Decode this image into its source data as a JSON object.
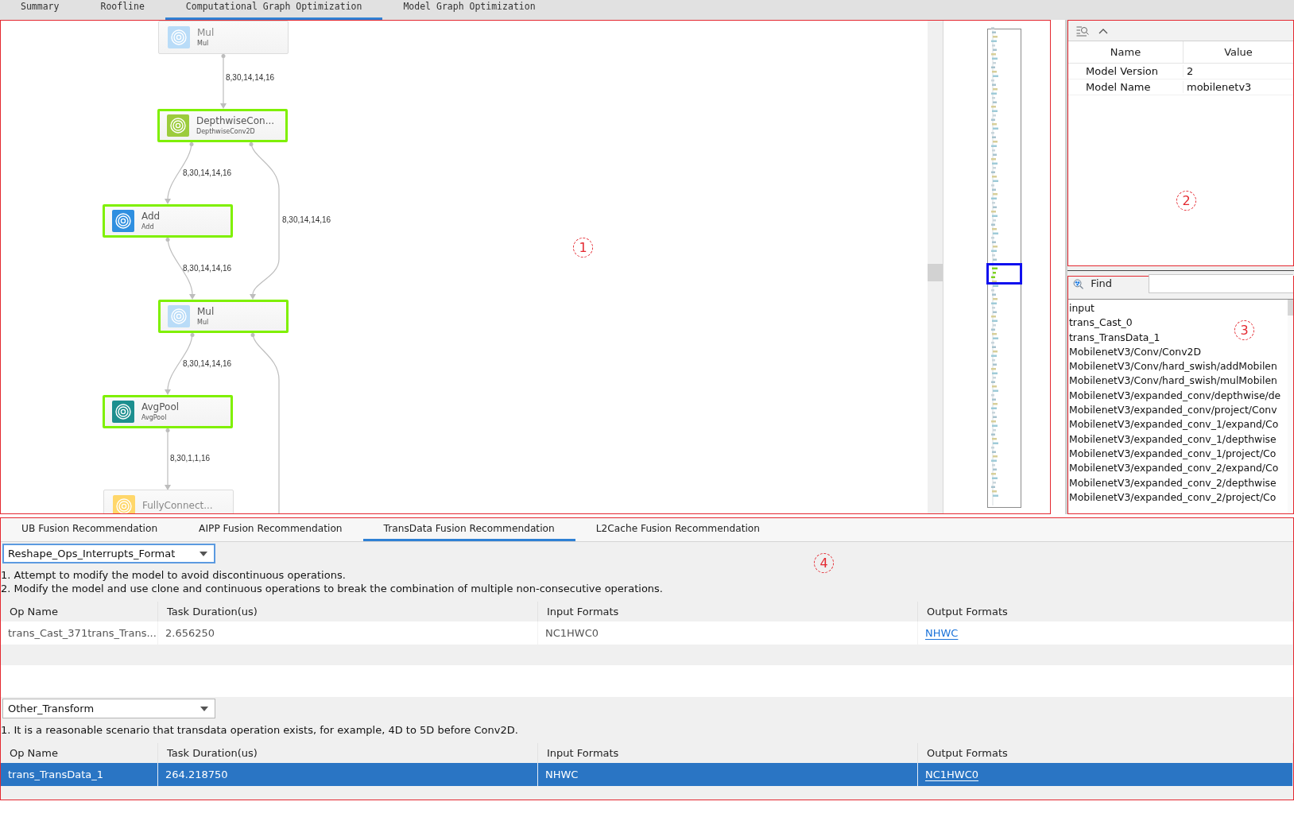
{
  "top_tabs": [
    {
      "label": "Summary",
      "selected": false
    },
    {
      "label": "Roofline",
      "selected": false
    },
    {
      "label": "Computational Graph Optimization",
      "selected": true
    },
    {
      "label": "Model Graph Optimization",
      "selected": false
    }
  ],
  "graph": {
    "callout": "1",
    "nodes": [
      {
        "title": "Mul",
        "subtitle": "Mul",
        "highlighted": false,
        "color": "#b9dcf8"
      },
      {
        "title": "DepthwiseCon...",
        "subtitle": "DepthwiseConv2D",
        "highlighted": true,
        "color": "#9ccc3c"
      },
      {
        "title": "Add",
        "subtitle": "Add",
        "highlighted": true,
        "color": "#2f8fe0"
      },
      {
        "title": "Mul",
        "subtitle": "Mul",
        "highlighted": true,
        "color": "#b9dcf8"
      },
      {
        "title": "AvgPool",
        "subtitle": "AvgPool",
        "highlighted": true,
        "color": "#1d8f8f"
      },
      {
        "title": "FullyConnect...",
        "highlighted": false,
        "color": "#ffd76a"
      }
    ],
    "edges": [
      {
        "kind": "arrow",
        "label": "8,30,14,14,16"
      },
      {
        "kind": "arrow",
        "label": "8,30,14,14,16"
      },
      {
        "kind": "arrow",
        "label": "8,30,14,14,16"
      },
      {
        "kind": "arrow",
        "label": "8,30,14,14,16"
      },
      {
        "kind": "arrow",
        "label": "8,30,14,14,16"
      },
      {
        "kind": "open"
      },
      {
        "kind": "arrow",
        "label": "8,30,1,1,16"
      }
    ]
  },
  "properties": {
    "callout": "2",
    "columns": [
      "Name",
      "Value"
    ],
    "rows": [
      {
        "name": "Model Version",
        "value": "2"
      },
      {
        "name": "Model Name",
        "value": "mobilenetv3"
      }
    ]
  },
  "find": {
    "callout": "3",
    "label": "Find",
    "results": [
      "input",
      "trans_Cast_0",
      "trans_TransData_1",
      "MobilenetV3/Conv/Conv2D",
      "MobilenetV3/Conv/hard_swish/addMobilen",
      "MobilenetV3/Conv/hard_swish/mulMobilen",
      "MobilenetV3/expanded_conv/depthwise/de",
      "MobilenetV3/expanded_conv/project/Conv",
      "MobilenetV3/expanded_conv_1/expand/Co",
      "MobilenetV3/expanded_conv_1/depthwise",
      "MobilenetV3/expanded_conv_1/project/Co",
      "MobilenetV3/expanded_conv_2/expand/Co",
      "MobilenetV3/expanded_conv_2/depthwise",
      "MobilenetV3/expanded_conv_2/project/Co"
    ]
  },
  "recommendations": {
    "callout": "4",
    "tabs": [
      {
        "label": "UB Fusion Recommendation",
        "selected": false
      },
      {
        "label": "AIPP Fusion Recommendation",
        "selected": false
      },
      {
        "label": "TransData Fusion Recommendation",
        "selected": true
      },
      {
        "label": "L2Cache Fusion Recommendation",
        "selected": false
      }
    ],
    "sections": [
      {
        "dropdown": {
          "value": "Reshape_Ops_Interrupts_Format",
          "focused": true
        },
        "notes": [
          "1. Attempt to modify the model to avoid discontinuous operations.",
          "2. Modify the model and use clone and continuous operations to break the combination of multiple non-consecutive operations."
        ],
        "table": {
          "columns": [
            "Op Name",
            "Task Duration(us)",
            "Input Formats",
            "Output Formats"
          ],
          "rows": [
            {
              "op_name": "trans_Cast_371trans_Trans...",
              "task_duration": "2.656250",
              "input_formats": "NC1HWC0",
              "output_formats": "NHWC",
              "selected": false
            }
          ]
        }
      },
      {
        "dropdown": {
          "value": "Other_Transform",
          "focused": false
        },
        "notes": [
          "1. It is a reasonable scenario that transdata operation exists, for example, 4D to 5D before Conv2D."
        ],
        "table": {
          "columns": [
            "Op Name",
            "Task Duration(us)",
            "Input Formats",
            "Output Formats"
          ],
          "rows": [
            {
              "op_name": "trans_TransData_1",
              "task_duration": "264.218750",
              "input_formats": "NHWC",
              "output_formats": "NC1HWC0",
              "selected": true
            }
          ]
        }
      }
    ]
  }
}
